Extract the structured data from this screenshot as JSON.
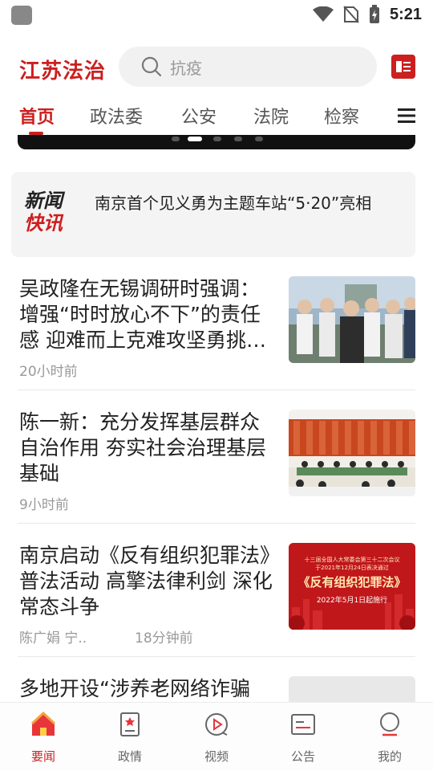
{
  "status_bar": {
    "time": "5:21"
  },
  "header": {
    "logo": "江苏法治",
    "search_placeholder": "抗疫"
  },
  "tabs": [
    {
      "label": "首页",
      "active": true
    },
    {
      "label": "政法委",
      "active": false
    },
    {
      "label": "公安",
      "active": false
    },
    {
      "label": "法院",
      "active": false
    },
    {
      "label": "检察",
      "active": false
    }
  ],
  "flash": {
    "logo_line1": "新闻",
    "logo_line2": "快讯",
    "text": "南京首个见义勇为主题车站“5·20”亮相"
  },
  "articles": [
    {
      "title": "吴政隆在无锡调研时强调：增强“时时放心不下”的责任感 迎难而上克难攻坚勇挑…",
      "time": "20小时前",
      "author": ""
    },
    {
      "title": "陈一新：充分发挥基层群众自治作用 夯实社会治理基层基础",
      "time": "9小时前",
      "author": ""
    },
    {
      "title": "南京启动《反有组织犯罪法》普法活动 高擎法律利剑 深化常态斗争",
      "time": "18分钟前",
      "author": "陈广娟 宁..",
      "thumb_line1": "十三届全国人大常委会第三十二次会议",
      "thumb_line2": "于2021年12月24日表决通过",
      "thumb_title": "《反有组织犯罪法》",
      "thumb_date": "2022年5月1日起施行"
    },
    {
      "title": "多地开设“涉养老网络诈骗",
      "time": "",
      "author": ""
    }
  ],
  "bottom_nav": [
    {
      "label": "要闻",
      "icon": "home-icon",
      "active": true
    },
    {
      "label": "政情",
      "icon": "document-star-icon",
      "active": false
    },
    {
      "label": "视频",
      "icon": "video-play-icon",
      "active": false
    },
    {
      "label": "公告",
      "icon": "notice-icon",
      "active": false
    },
    {
      "label": "我的",
      "icon": "profile-icon",
      "active": false
    }
  ],
  "colors": {
    "brand_red": "#cc1f1f",
    "text_dark": "#222222",
    "text_muted": "#999999"
  }
}
